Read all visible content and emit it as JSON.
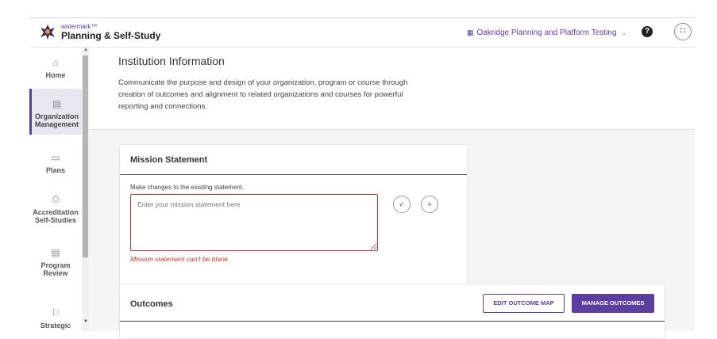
{
  "header": {
    "brand_small": "watermark™",
    "brand_name": "Planning & Self-Study",
    "org_name": "Oakridge Planning and Platform Testing",
    "help_label": "?",
    "apps_label": "∷"
  },
  "sidebar": {
    "items": [
      {
        "label": "Home",
        "icon": "home-icon"
      },
      {
        "label": "Organization Management",
        "icon": "folder-icon"
      },
      {
        "label": "Plans",
        "icon": "plans-icon"
      },
      {
        "label": "Accreditation Self-Studies",
        "icon": "accreditation-icon"
      },
      {
        "label": "Program Review",
        "icon": "review-icon"
      },
      {
        "label": "Strategic",
        "icon": "strategic-icon"
      }
    ]
  },
  "info": {
    "title": "Institution Information",
    "description": "Communicate the purpose and design of your organization, program or course through creation of outcomes and alignment to related organizations and courses for powerful reporting and connections."
  },
  "mission": {
    "title": "Mission Statement",
    "help_text": "Make changes to the existing statement.",
    "placeholder": "Enter your mission statement here",
    "value": "",
    "confirm_icon": "✓",
    "cancel_icon": "×",
    "error": "Mission statement can't be blank."
  },
  "outcomes": {
    "title": "Outcomes",
    "edit_map_label": "EDIT OUTCOME MAP",
    "manage_label": "MANAGE OUTCOMES"
  },
  "colors": {
    "accent": "#5b3fa0",
    "error": "#c0392b"
  }
}
